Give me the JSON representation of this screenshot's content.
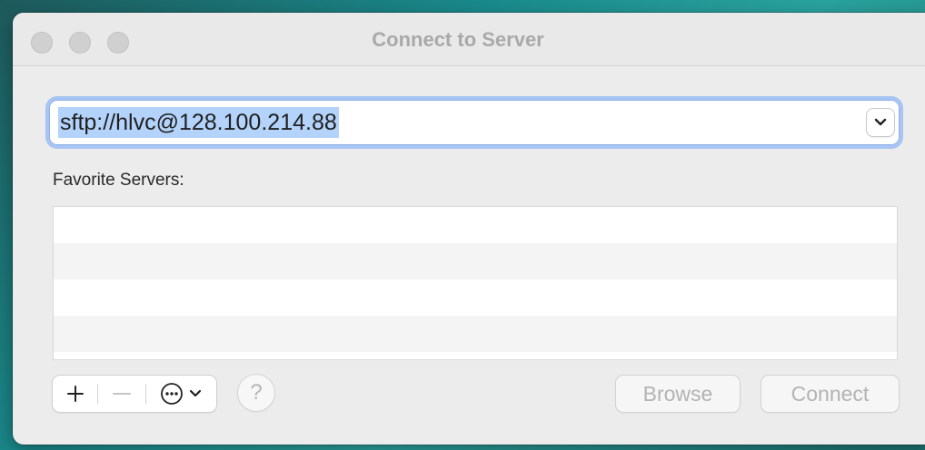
{
  "window": {
    "title": "Connect to Server"
  },
  "address": {
    "value": "sftp://hlvc@128.100.214.88"
  },
  "favorites": {
    "label": "Favorite Servers:",
    "rows": [
      "",
      "",
      "",
      ""
    ]
  },
  "toolbar": {
    "add_icon": "plus-icon",
    "remove_icon": "minus-icon",
    "more_icon": "ellipsis-circle-icon",
    "help_label": "?"
  },
  "buttons": {
    "browse": "Browse",
    "connect": "Connect"
  },
  "colors": {
    "selection": "#b3d3fb",
    "focus_ring": "#a7c4f2",
    "disabled_text": "#b3b3b3"
  }
}
